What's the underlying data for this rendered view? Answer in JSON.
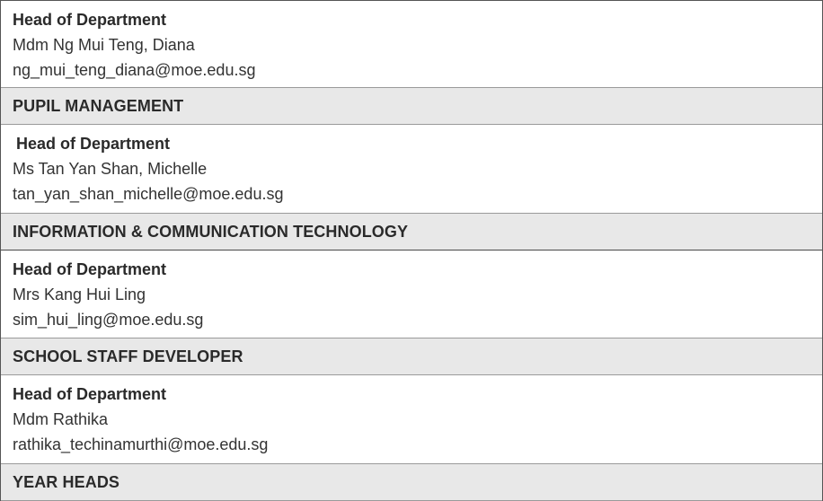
{
  "rows": [
    {
      "type": "contact",
      "role": "Head of Department",
      "name": "Mdm Ng Mui Teng, Diana",
      "email": "ng_mui_teng_diana@moe.edu.sg"
    },
    {
      "type": "header",
      "title": "PUPIL MANAGEMENT"
    },
    {
      "type": "contact",
      "role": "Head of Department",
      "name": "Ms Tan Yan Shan, Michelle",
      "email": "tan_yan_shan_michelle@moe.edu.sg"
    },
    {
      "type": "header",
      "title": "INFORMATION & COMMUNICATION TECHNOLOGY"
    },
    {
      "type": "contact",
      "role": "Head of Department",
      "name": "Mrs Kang Hui Ling",
      "email": "sim_hui_ling@moe.edu.sg"
    },
    {
      "type": "header",
      "title": "SCHOOL STAFF DEVELOPER"
    },
    {
      "type": "contact",
      "role": "Head of Department",
      "name": "Mdm Rathika",
      "email": "rathika_techinamurthi@moe.edu.sg"
    },
    {
      "type": "header",
      "title": "YEAR HEADS"
    }
  ]
}
